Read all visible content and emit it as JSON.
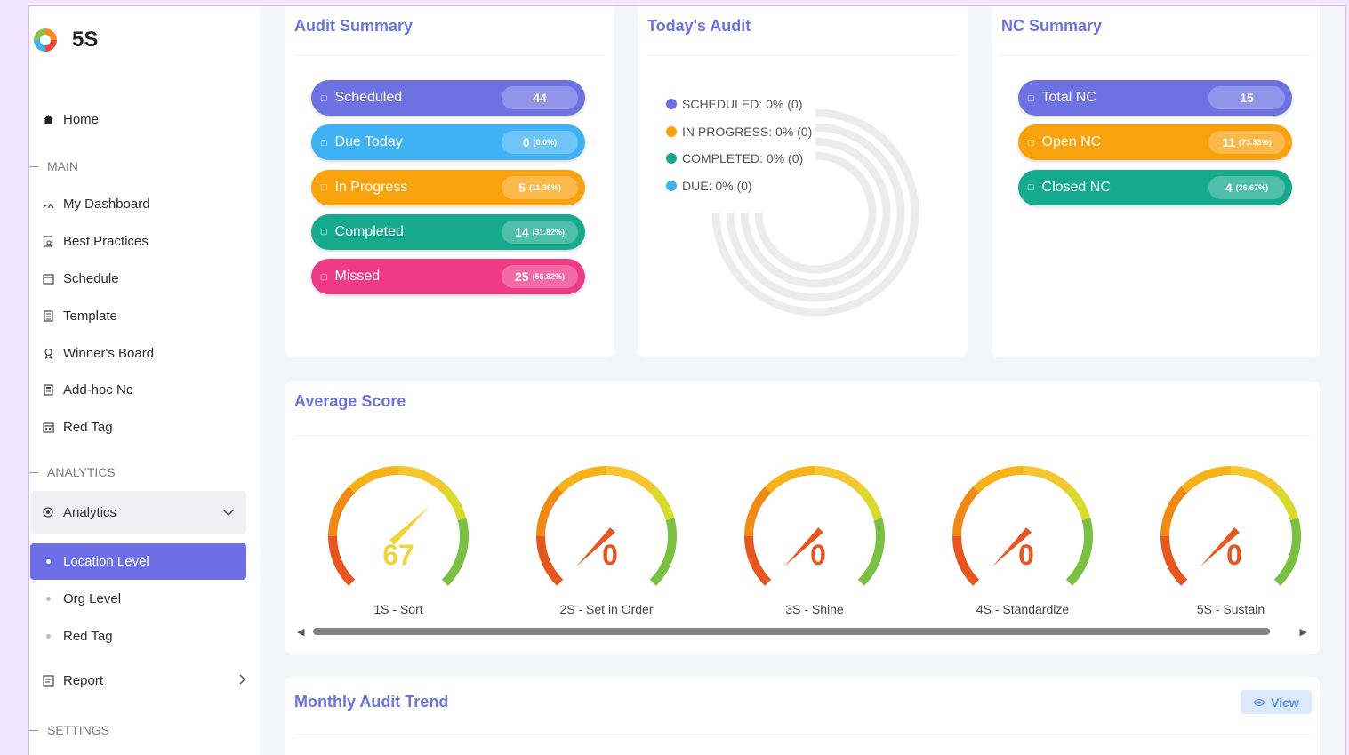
{
  "app": {
    "name": "5S"
  },
  "sidebar": {
    "home": "Home",
    "sections": {
      "main": "MAIN",
      "analytics": "ANALYTICS",
      "settings": "SETTINGS"
    },
    "main_items": [
      {
        "label": "My Dashboard",
        "icon": "dashboard-icon"
      },
      {
        "label": "Best Practices",
        "icon": "document-search-icon"
      },
      {
        "label": "Schedule",
        "icon": "calendar-icon"
      },
      {
        "label": "Template",
        "icon": "template-icon"
      },
      {
        "label": "Winner's Board",
        "icon": "award-icon"
      },
      {
        "label": "Add-hoc Nc",
        "icon": "form-icon"
      },
      {
        "label": "Red Tag",
        "icon": "calendar-icon"
      }
    ],
    "analytics": {
      "label": "Analytics",
      "expanded": true,
      "items": [
        {
          "label": "Location Level",
          "active": true
        },
        {
          "label": "Org Level",
          "active": false
        },
        {
          "label": "Red Tag",
          "active": false
        }
      ]
    },
    "report": "Report"
  },
  "audit_summary": {
    "title": "Audit Summary",
    "items": [
      {
        "label": "Scheduled",
        "value": "44",
        "pct": "",
        "color": "#6d72e3"
      },
      {
        "label": "Due Today",
        "value": "0",
        "pct": "(0.0%)",
        "color": "#3fb2f3"
      },
      {
        "label": "In Progress",
        "value": "5",
        "pct": "(11.36%)",
        "color": "#f8a20e"
      },
      {
        "label": "Completed",
        "value": "14",
        "pct": "(31.82%)",
        "color": "#15a98e"
      },
      {
        "label": "Missed",
        "value": "25",
        "pct": "(56.82%)",
        "color": "#ef3a86"
      }
    ]
  },
  "todays_audit": {
    "title": "Today's Audit",
    "legend": [
      {
        "label": "SCHEDULED: 0% (0)",
        "color": "#6d72e3"
      },
      {
        "label": "IN PROGRESS: 0% (0)",
        "color": "#f8a20e"
      },
      {
        "label": "COMPLETED: 0% (0)",
        "color": "#15a98e"
      },
      {
        "label": "DUE: 0% (0)",
        "color": "#3fb2f3"
      }
    ]
  },
  "nc_summary": {
    "title": "NC Summary",
    "items": [
      {
        "label": "Total NC",
        "value": "15",
        "pct": "",
        "color": "#6d72e3"
      },
      {
        "label": "Open NC",
        "value": "11",
        "pct": "(73.33%)",
        "color": "#f8a20e"
      },
      {
        "label": "Closed NC",
        "value": "4",
        "pct": "(26.67%)",
        "color": "#15a98e"
      }
    ]
  },
  "average_score": {
    "title": "Average Score",
    "gauges": [
      {
        "label": "1S - Sort",
        "value": "67",
        "score": 67
      },
      {
        "label": "2S - Set in Order",
        "value": "0",
        "score": 0
      },
      {
        "label": "3S - Shine",
        "value": "0",
        "score": 0
      },
      {
        "label": "4S - Standardize",
        "value": "0",
        "score": 0
      },
      {
        "label": "5S - Sustain",
        "value": "0",
        "score": 0
      }
    ]
  },
  "monthly_trend": {
    "title": "Monthly Audit Trend",
    "view_label": "View"
  }
}
